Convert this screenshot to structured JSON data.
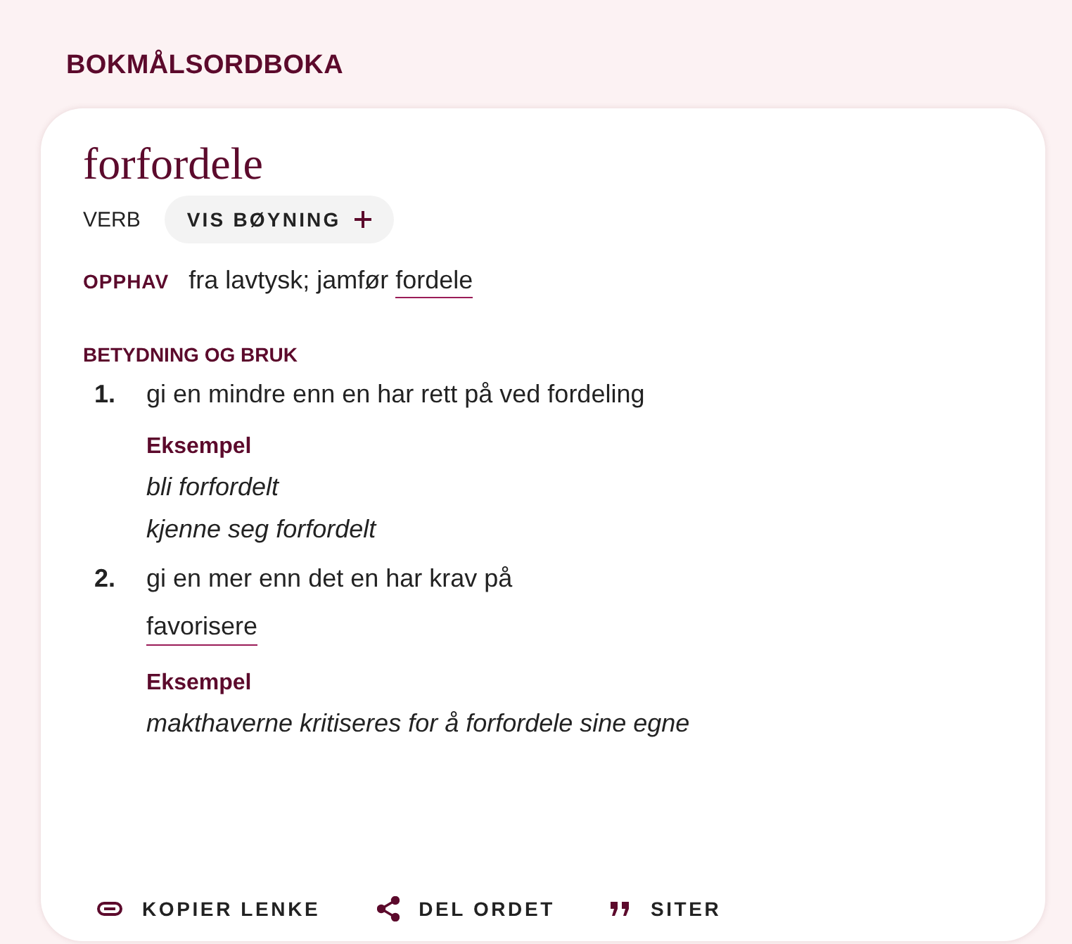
{
  "dictionary_title": "BOKMÅLSORDBOKA",
  "article": {
    "lemma": "forfordele",
    "word_class": "VERB",
    "inflection_button": {
      "label": "VIS BØYNING",
      "expanded": false
    },
    "origin": {
      "label": "OPPHAV",
      "text": "fra lavtysk; jamfør",
      "link": "fordele"
    },
    "meanings_heading": "BETYDNING OG BRUK",
    "definitions": [
      {
        "number": "1.",
        "text": "gi en mindre enn en har rett på ved fordeling",
        "example_label": "Eksempel",
        "examples": [
          "bli forfordelt",
          "kjenne seg forfordelt"
        ]
      },
      {
        "number": "2.",
        "text": "gi en mer enn det en har krav på",
        "links": [
          "favorisere"
        ],
        "example_label": "Eksempel",
        "examples": [
          "makthaverne kritiseres for å forfordele sine egne"
        ]
      }
    ],
    "actions": [
      {
        "kind": "link",
        "label": "KOPIER LENKE"
      },
      {
        "kind": "share",
        "label": "DEL ORDET"
      },
      {
        "kind": "quote",
        "label": "SITER"
      }
    ]
  }
}
